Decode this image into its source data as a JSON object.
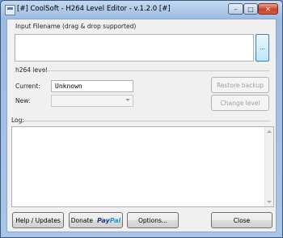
{
  "window": {
    "title": "[#] CoolSoft - H264 Level Editor - v.1.2.0 [#]",
    "minimize": "–",
    "maximize": "□",
    "close": "✕"
  },
  "input": {
    "label": "Input Filename (drag & drop supported)",
    "value": "",
    "browse_label": "..."
  },
  "h264": {
    "section_label": "h264 level",
    "current_label": "Current:",
    "current_value": "Unknown",
    "new_label": "New:",
    "new_value": "",
    "restore_button": "Restore backup",
    "change_button": "Change level"
  },
  "log": {
    "label": "Log:",
    "content": ""
  },
  "footer": {
    "help_button": "Help / Updates",
    "donate_label": "Donate",
    "donate_brand_pay": "Pay",
    "donate_brand_pal": "Pal",
    "options_button": "Options...",
    "close_button": "Close"
  }
}
